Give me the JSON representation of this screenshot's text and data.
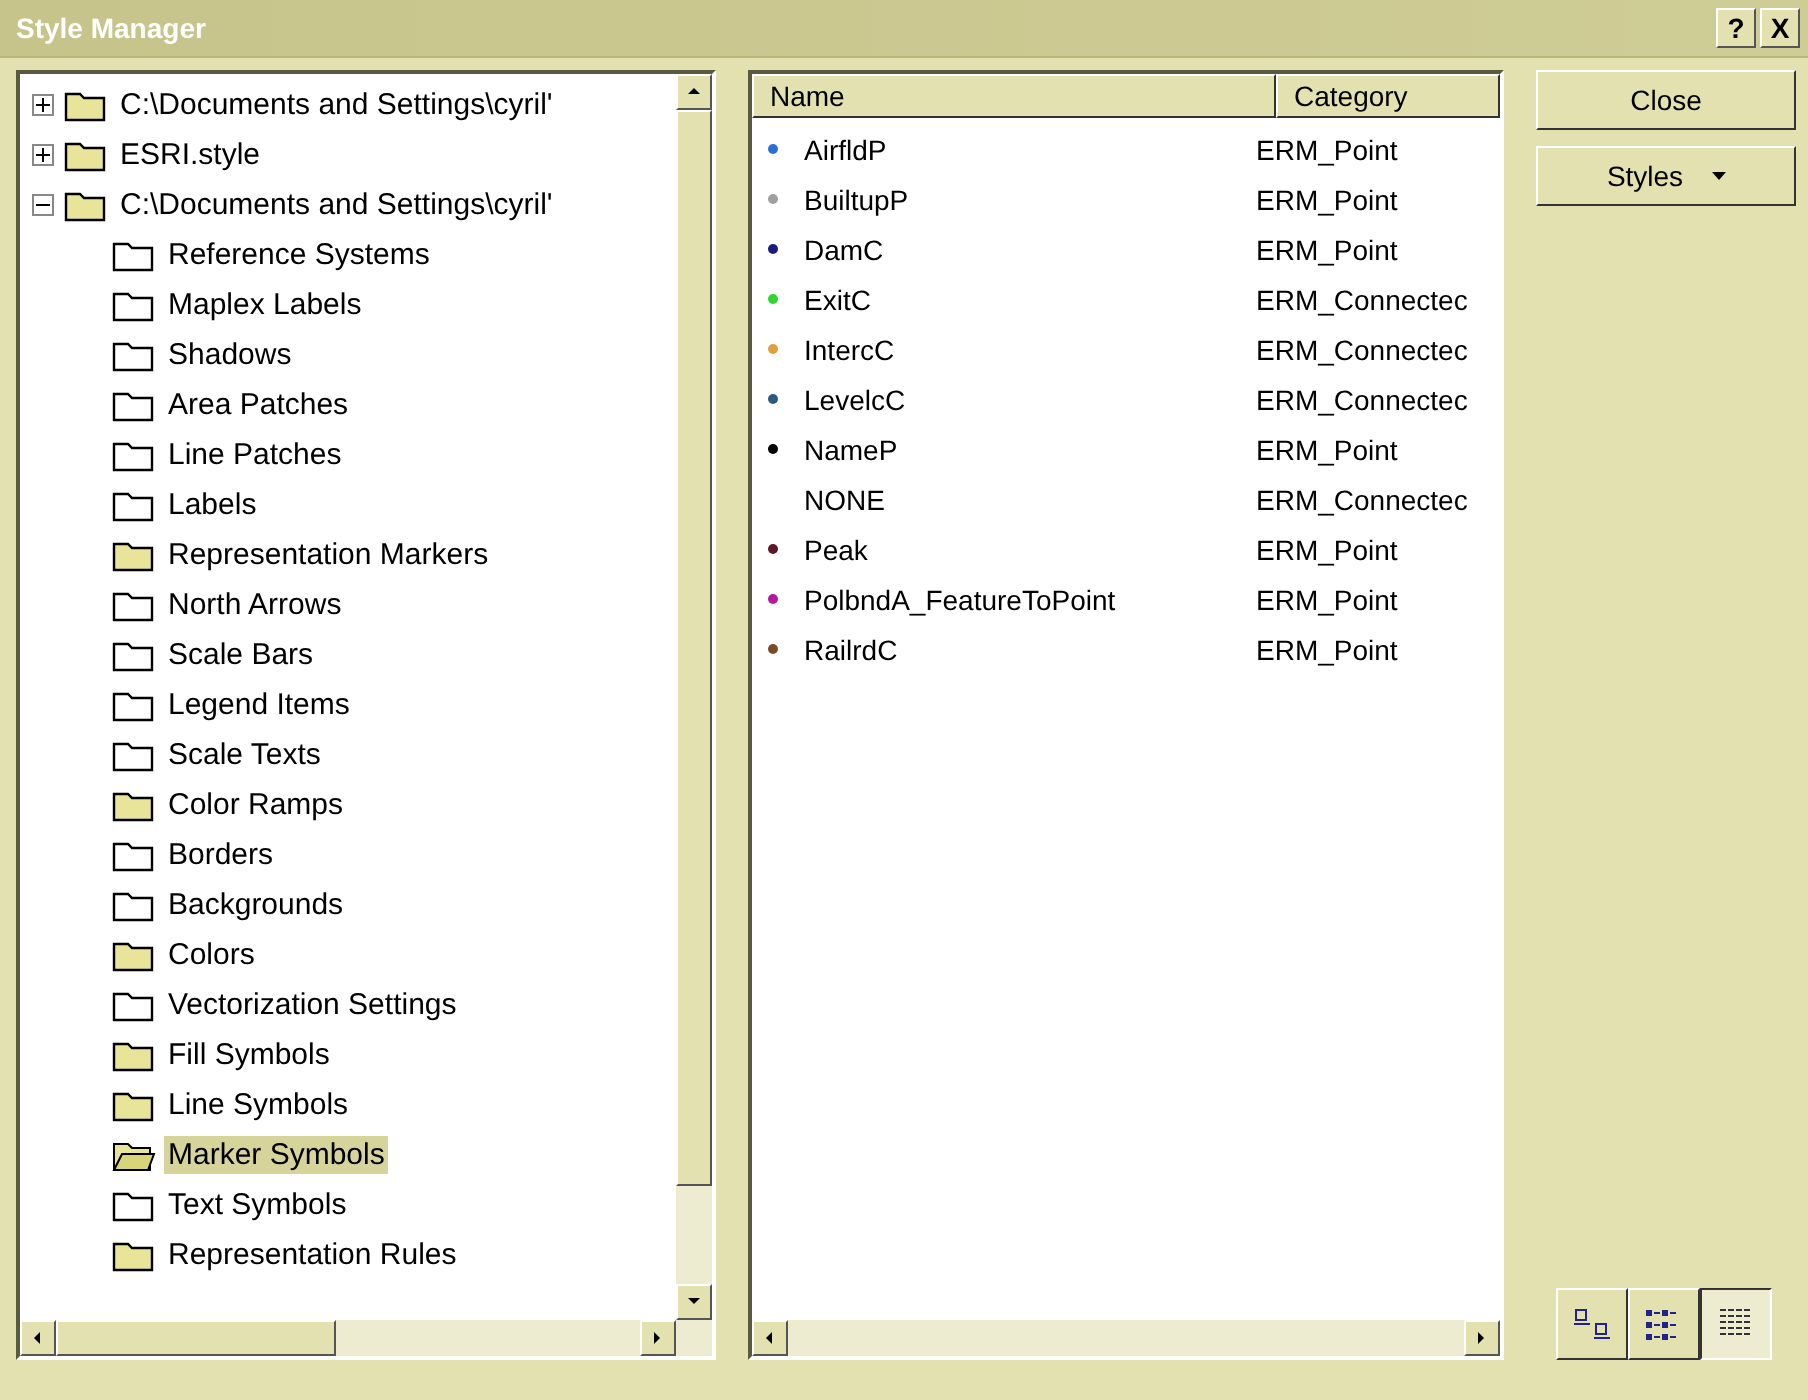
{
  "window": {
    "title": "Style Manager",
    "title_buttons": [
      "?",
      "X"
    ]
  },
  "tree": [
    {
      "label": "C:\\Documents and Settings\\cyril'",
      "kind": "filled",
      "expanded": false,
      "selected": false
    },
    {
      "label": "ESRI.style",
      "kind": "filled",
      "expanded": false,
      "selected": false
    },
    {
      "label": "C:\\Documents and Settings\\cyril'",
      "kind": "filled",
      "expanded": true,
      "selected": false,
      "children": [
        {
          "label": "Reference Systems",
          "kind": "empty",
          "selected": false
        },
        {
          "label": "Maplex Labels",
          "kind": "empty",
          "selected": false
        },
        {
          "label": "Shadows",
          "kind": "empty",
          "selected": false
        },
        {
          "label": "Area Patches",
          "kind": "empty",
          "selected": false
        },
        {
          "label": "Line Patches",
          "kind": "empty",
          "selected": false
        },
        {
          "label": "Labels",
          "kind": "empty",
          "selected": false
        },
        {
          "label": "Representation Markers",
          "kind": "filled",
          "selected": false
        },
        {
          "label": "North Arrows",
          "kind": "empty",
          "selected": false
        },
        {
          "label": "Scale Bars",
          "kind": "empty",
          "selected": false
        },
        {
          "label": "Legend Items",
          "kind": "empty",
          "selected": false
        },
        {
          "label": "Scale Texts",
          "kind": "empty",
          "selected": false
        },
        {
          "label": "Color Ramps",
          "kind": "filled",
          "selected": false
        },
        {
          "label": "Borders",
          "kind": "empty",
          "selected": false
        },
        {
          "label": "Backgrounds",
          "kind": "empty",
          "selected": false
        },
        {
          "label": "Colors",
          "kind": "filled",
          "selected": false
        },
        {
          "label": "Vectorization Settings",
          "kind": "empty",
          "selected": false
        },
        {
          "label": "Fill Symbols",
          "kind": "filled",
          "selected": false
        },
        {
          "label": "Line Symbols",
          "kind": "filled",
          "selected": false
        },
        {
          "label": "Marker Symbols",
          "kind": "open",
          "selected": true
        },
        {
          "label": "Text Symbols",
          "kind": "empty",
          "selected": false
        },
        {
          "label": "Representation Rules",
          "kind": "filled",
          "selected": false
        }
      ]
    }
  ],
  "table": {
    "columns": [
      "Name",
      "Category"
    ],
    "rows": [
      {
        "name": "AirfldP",
        "category": "ERM_Point",
        "color": "#2a6fd6"
      },
      {
        "name": "BuiltupP",
        "category": "ERM_Point",
        "color": "#a0a0a0"
      },
      {
        "name": "DamC",
        "category": "ERM_Point",
        "color": "#1a1a80"
      },
      {
        "name": "ExitC",
        "category": "ERM_Connectec",
        "color": "#2ed62e"
      },
      {
        "name": "IntercC",
        "category": "ERM_Connectec",
        "color": "#e0a040"
      },
      {
        "name": "LevelcC",
        "category": "ERM_Connectec",
        "color": "#2a5a80"
      },
      {
        "name": "NameP",
        "category": "ERM_Point",
        "color": "#000000"
      },
      {
        "name": "NONE",
        "category": "ERM_Connectec"
      },
      {
        "name": "Peak",
        "category": "ERM_Point",
        "color": "#5a1a2a"
      },
      {
        "name": "PolbndA_FeatureToPoint",
        "category": "ERM_Point",
        "color": "#b01aa0"
      },
      {
        "name": "RailrdC",
        "category": "ERM_Point",
        "color": "#7a4a2a"
      }
    ]
  },
  "buttons": [
    {
      "label": "Close",
      "kind": "plain"
    },
    {
      "label": "Styles",
      "kind": "menu"
    }
  ],
  "view_buttons": [
    {
      "kind": "large",
      "selected": false
    },
    {
      "kind": "list",
      "selected": false
    },
    {
      "kind": "details",
      "selected": true
    }
  ]
}
